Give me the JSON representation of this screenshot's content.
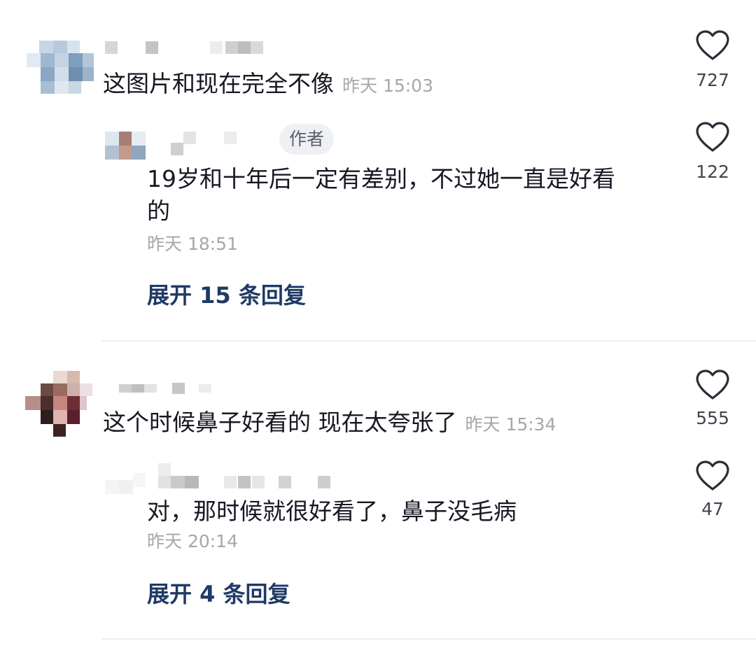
{
  "comments": [
    {
      "text": "这图片和现在完全不像",
      "time": "昨天 15:03",
      "likes": "727",
      "reply": {
        "badge": "作者",
        "text_line1": "19岁和十年后一定有差别，不过她一直是好看",
        "text_line2": "的",
        "time": "昨天 18:51",
        "likes": "122"
      },
      "expand": "展开 15 条回复"
    },
    {
      "text": "这个时候鼻子好看的 现在太夸张了",
      "time": "昨天 15:34",
      "likes": "555",
      "reply": {
        "text": "对，那时候就很好看了，鼻子没毛病",
        "time": "昨天 20:14",
        "likes": "47"
      },
      "expand": "展开 4 条回复"
    }
  ],
  "icons": {
    "like": "heart-outline-icon"
  },
  "colors": {
    "text": "#161823",
    "meta": "#a7a7ab",
    "expand": "#1f3a64",
    "heart": "#2b2d36"
  }
}
